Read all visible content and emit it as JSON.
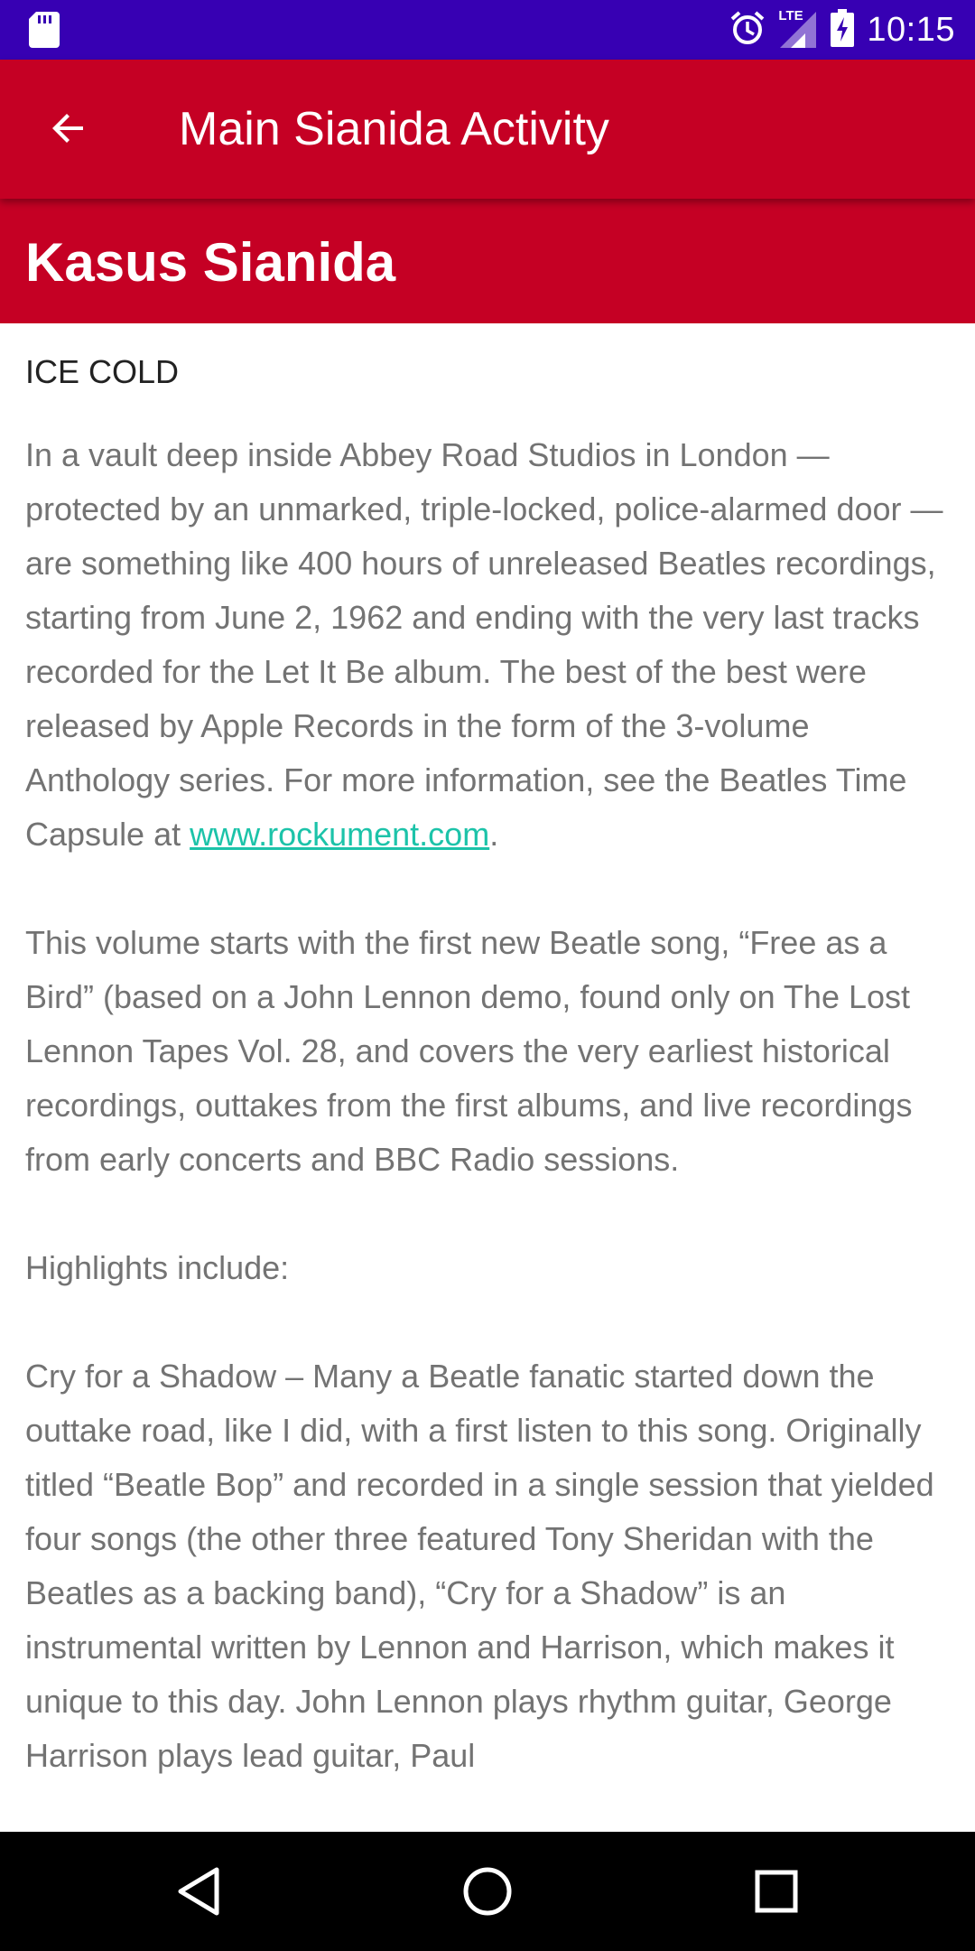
{
  "status_bar": {
    "time": "10:15",
    "icons": [
      "sd-card-icon",
      "alarm-icon",
      "lte-signal-icon",
      "battery-charging-icon"
    ],
    "network_label": "LTE"
  },
  "app_bar": {
    "title": "Main Sianida Activity",
    "back_icon": "arrow-back-icon"
  },
  "header": {
    "title": "Kasus Sianida"
  },
  "article": {
    "subtitle": "ICE COLD",
    "paragraph1_text": "In a vault deep inside Abbey Road Studios in London — protected by an unmarked, triple-locked, police-alarmed door — are something like 400 hours of unreleased Beatles recordings, starting from June 2, 1962 and ending with the very last tracks recorded for the Let It Be album. The best of the best were released by Apple Records in the form of the 3-volume Anthology series. For more information, see the Beatles Time Capsule at ",
    "paragraph1_link": "www.rockument.com",
    "paragraph1_end": ".",
    "paragraph2": " This volume starts with the first new Beatle song, “Free as a Bird” (based on a John Lennon demo, found only on The Lost Lennon Tapes Vol. 28, and covers the very earliest historical recordings, outtakes from the first albums, and live recordings from early concerts and BBC Radio sessions.",
    "paragraph3": " Highlights include:",
    "paragraph4": " Cry for a Shadow – Many a Beatle fanatic started down the outtake road, like I did, with a first listen to this song. Originally titled “Beatle Bop” and recorded in a single session that yielded four songs (the other three featured Tony Sheridan with the Beatles as a backing band), “Cry for a Shadow” is an instrumental written by Lennon and Harrison, which makes it unique to this day. John Lennon plays rhythm guitar, George Harrison plays lead guitar, Paul"
  },
  "colors": {
    "status_bar": "#3700b3",
    "primary": "#c50024",
    "link": "#1cc3a9",
    "body_text": "#737373"
  },
  "nav_bar": {
    "icons": [
      "nav-back-icon",
      "nav-home-icon",
      "nav-recents-icon"
    ]
  }
}
